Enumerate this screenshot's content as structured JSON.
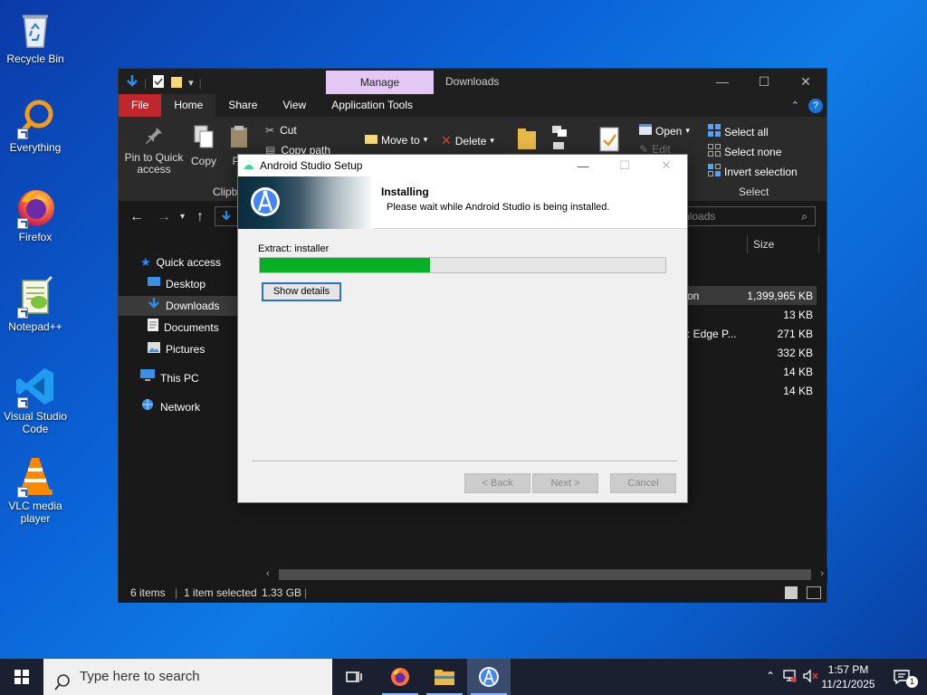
{
  "desktop": {
    "icons": [
      {
        "label": "Recycle Bin",
        "icon": "recycle-bin-icon"
      },
      {
        "label": "Everything",
        "icon": "everything-search-icon"
      },
      {
        "label": "Firefox",
        "icon": "firefox-icon"
      },
      {
        "label": "Notepad++",
        "icon": "notepad-plus-plus-icon"
      },
      {
        "label": "Visual Studio Code",
        "icon": "vscode-icon"
      },
      {
        "label": "VLC media player",
        "icon": "vlc-icon"
      }
    ]
  },
  "explorer": {
    "context_tab": "Manage",
    "title": "Downloads",
    "ribbon_tabs": [
      "File",
      "Home",
      "Share",
      "View",
      "Application Tools"
    ],
    "ribbon": {
      "pin_label": "Pin to Quick access",
      "copy_label": "Copy",
      "paste_label": "Pa",
      "cut_label": "Cut",
      "copy_path_label": "Copy path",
      "clipboard_group": "Clipb",
      "move_to_label": "Move to",
      "delete_label": "Delete",
      "open_label": "Open",
      "edit_label": "Edit",
      "select_all_label": "Select all",
      "select_none_label": "Select none",
      "invert_selection_label": "Invert selection",
      "select_group": "Select"
    },
    "search_placeholder": "nloads",
    "nav_items": [
      {
        "label": "Quick access",
        "icon": "star-icon"
      },
      {
        "label": "Desktop",
        "icon": "desktop-folder-icon"
      },
      {
        "label": "Downloads",
        "icon": "downloads-folder-icon"
      },
      {
        "label": "Documents",
        "icon": "documents-folder-icon"
      },
      {
        "label": "Pictures",
        "icon": "pictures-folder-icon"
      },
      {
        "label": "This PC",
        "icon": "computer-icon"
      },
      {
        "label": "Network",
        "icon": "network-icon"
      }
    ],
    "column_size": "Size",
    "files": [
      {
        "name_fragment": "on",
        "size": "1,399,965 KB"
      },
      {
        "name_fragment": "",
        "size": "13 KB"
      },
      {
        "name_fragment": ": Edge P...",
        "size": "271 KB"
      },
      {
        "name_fragment": "",
        "size": "332 KB"
      },
      {
        "name_fragment": "",
        "size": "14 KB"
      },
      {
        "name_fragment": "",
        "size": "14 KB"
      }
    ],
    "status": {
      "items": "6 items",
      "selected": "1 item selected",
      "size": "1.33 GB"
    }
  },
  "setup": {
    "title": "Android Studio Setup",
    "header_title": "Installing",
    "header_subtitle": "Please wait while Android Studio is being installed.",
    "extract_text": "Extract: installer",
    "progress": 0.42,
    "show_details": "Show details",
    "back": "< Back",
    "next": "Next >",
    "cancel": "Cancel"
  },
  "taskbar": {
    "search_placeholder": "Type here to search",
    "time": "1:57 PM",
    "date": "11/21/2025",
    "notification_count": "1"
  },
  "colors": {
    "file_tab": "#c0272d",
    "manage_tab": "#e3c8f4",
    "progress_fill": "#06b025",
    "accent": "#1a73d9"
  }
}
